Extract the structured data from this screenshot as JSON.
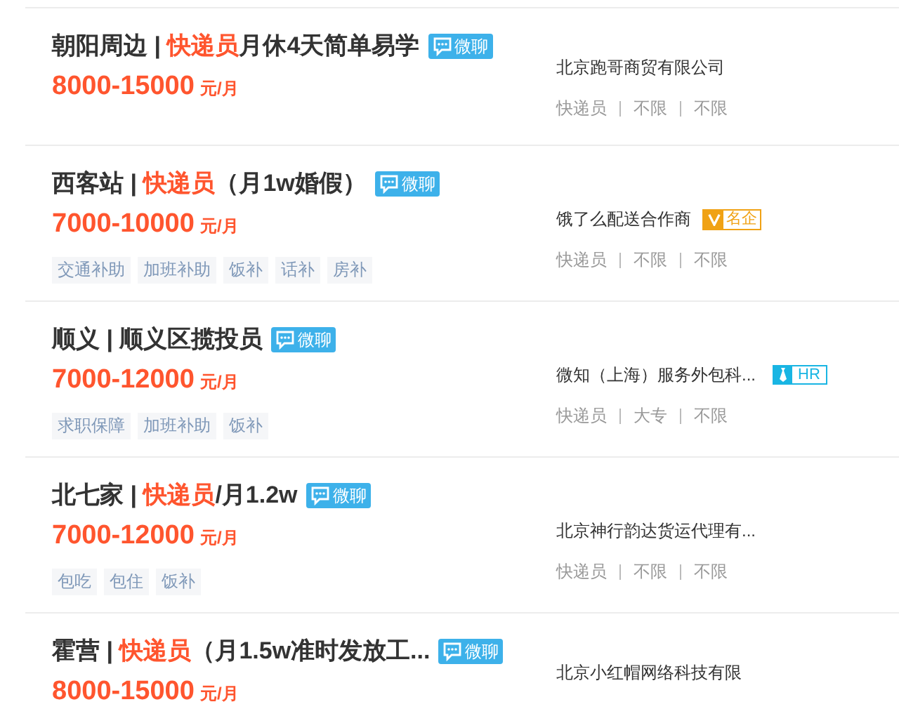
{
  "jobs": [
    {
      "title_parts": [
        {
          "text": "朝阳周边 | ",
          "highlight": false
        },
        {
          "text": "快递员",
          "highlight": true
        },
        {
          "text": "月休4天简单易学",
          "highlight": false
        }
      ],
      "chat_label": "微聊",
      "salary": "8000-15000",
      "salary_unit": "元/月",
      "company": "北京跑哥商贸有限公司",
      "meta": [
        "快递员",
        "不限",
        "不限"
      ]
    },
    {
      "title_parts": [
        {
          "text": "西客站 | ",
          "highlight": false
        },
        {
          "text": "快递员",
          "highlight": true
        },
        {
          "text": "（月1w婚假）",
          "highlight": false
        }
      ],
      "chat_label": "微聊",
      "salary": "7000-10000",
      "salary_unit": "元/月",
      "tags": [
        "交通补助",
        "加班补助",
        "饭补",
        "话补",
        "房补"
      ],
      "company": "饿了么配送合作商",
      "company_badge": {
        "kind": "famous",
        "label": "名企"
      },
      "meta": [
        "快递员",
        "不限",
        "不限"
      ]
    },
    {
      "title_parts": [
        {
          "text": "顺义 | 顺义区揽投员",
          "highlight": false
        }
      ],
      "chat_label": "微聊",
      "salary": "7000-12000",
      "salary_unit": "元/月",
      "tags": [
        "求职保障",
        "加班补助",
        "饭补"
      ],
      "company": "微知（上海）服务外包科...",
      "company_badge": {
        "kind": "hr",
        "label": "HR"
      },
      "meta": [
        "快递员",
        "大专",
        "不限"
      ]
    },
    {
      "title_parts": [
        {
          "text": "北七家 | ",
          "highlight": false
        },
        {
          "text": "快递员",
          "highlight": true
        },
        {
          "text": "/月1.2w",
          "highlight": false
        }
      ],
      "chat_label": "微聊",
      "salary": "7000-12000",
      "salary_unit": "元/月",
      "tags": [
        "包吃",
        "包住",
        "饭补"
      ],
      "company": "北京神行韵达货运代理有...",
      "meta": [
        "快递员",
        "不限",
        "不限"
      ]
    },
    {
      "title_parts": [
        {
          "text": "霍营 | ",
          "highlight": false
        },
        {
          "text": "快递员",
          "highlight": true
        },
        {
          "text": "（月1.5w准时发放工...",
          "highlight": false
        }
      ],
      "chat_label": "微聊",
      "salary": "8000-15000",
      "salary_unit": "元/月",
      "company": "北京小红帽网络科技有限"
    }
  ]
}
